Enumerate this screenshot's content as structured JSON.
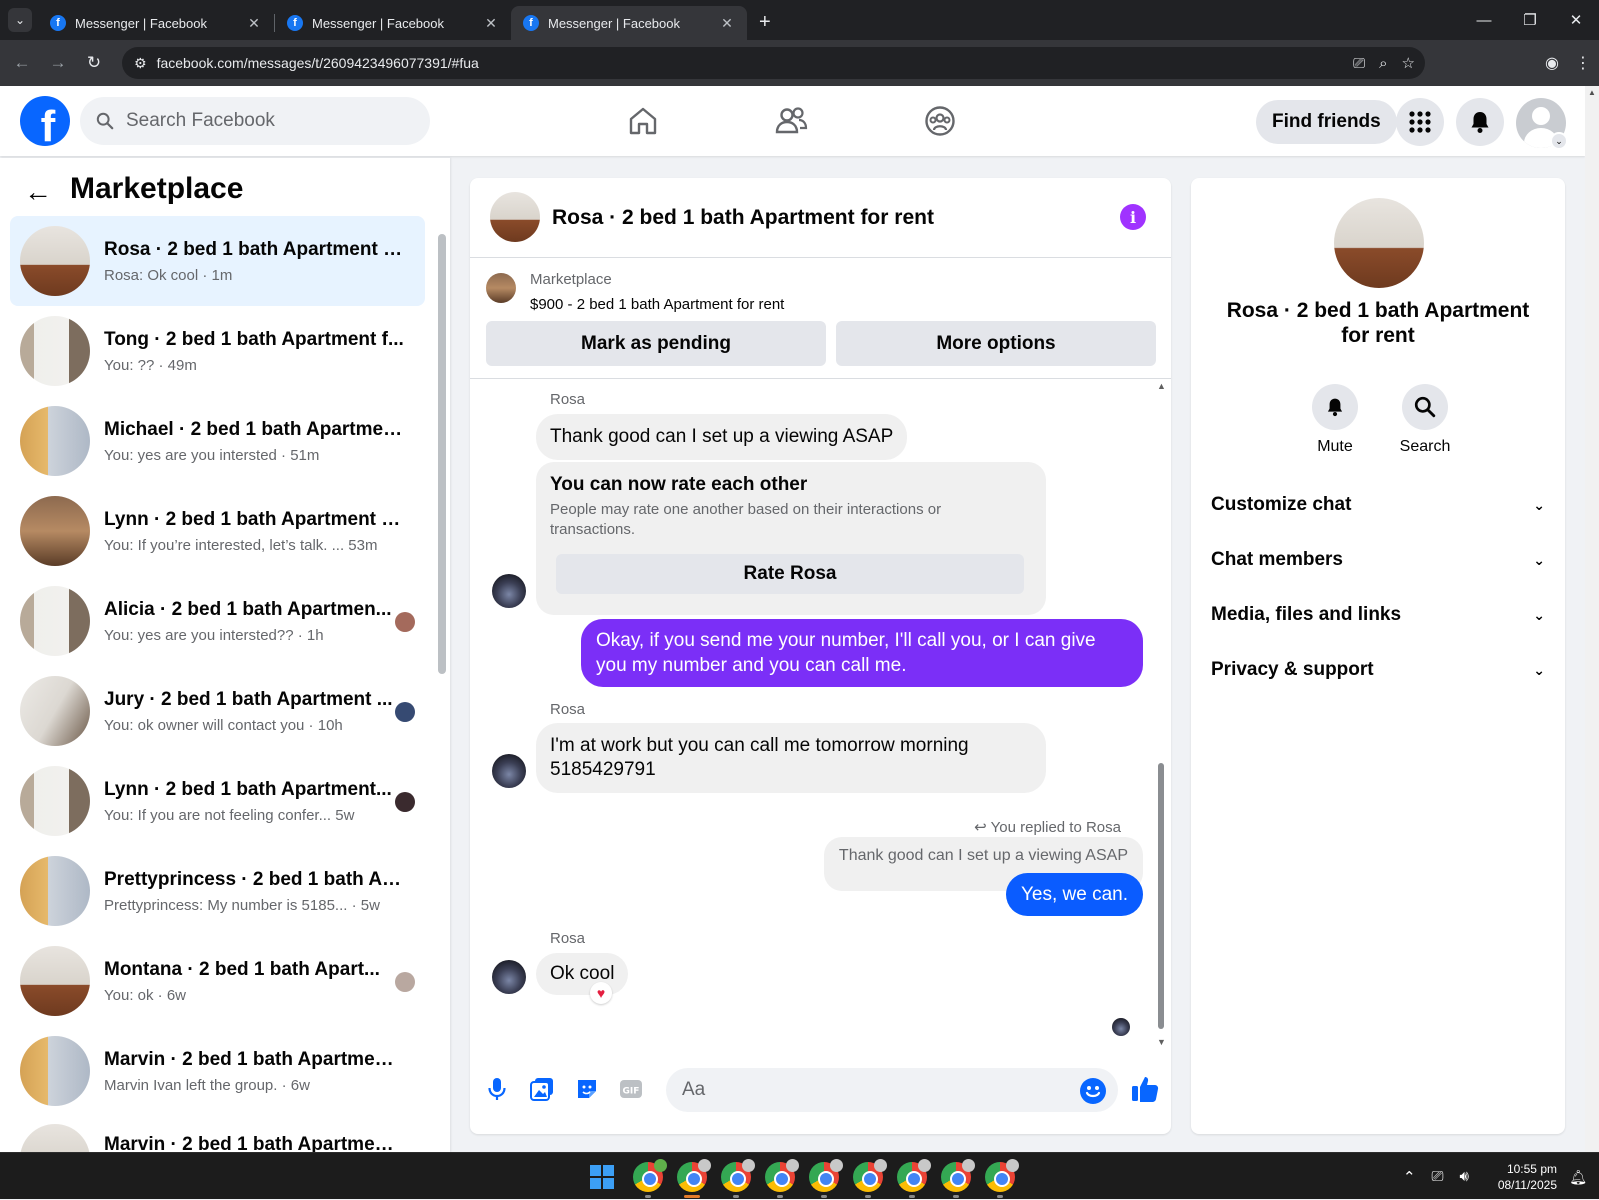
{
  "browser": {
    "tabs": [
      {
        "title": "Messenger | Facebook"
      },
      {
        "title": "Messenger | Facebook"
      },
      {
        "title": "Messenger | Facebook"
      }
    ],
    "url": "facebook.com/messages/t/2609423496077391/#fua"
  },
  "header": {
    "search_placeholder": "Search Facebook",
    "find_friends": "Find friends"
  },
  "left": {
    "title": "Marketplace",
    "conversations": [
      {
        "name": "Rosa · 2 bed 1 bath Apartment fo...",
        "preview": "Rosa: Ok cool · 1m",
        "selected": true
      },
      {
        "name": "Tong · 2 bed 1 bath Apartment f...",
        "preview": "You: ?? · 49m"
      },
      {
        "name": "Michael · 2 bed 1 bath Apartmen...",
        "preview": "You: yes are you intersted · 51m"
      },
      {
        "name": "Lynn · 2 bed 1 bath Apartment fo...",
        "preview": "You: If you’re interested, let’s talk. ... 53m"
      },
      {
        "name": "Alicia · 2 bed 1 bath Apartmen...",
        "preview": "You: yes are you intersted?? · 1h"
      },
      {
        "name": "Jury · 2 bed 1 bath Apartment ...",
        "preview": "You: ok owner will contact you · 10h"
      },
      {
        "name": "Lynn · 2 bed 1 bath Apartment...",
        "preview": "You: If you are not feeling confer...  5w"
      },
      {
        "name": "Prettyprincess · 2 bed 1 bath Apa...",
        "preview": "Prettyprincess: My number is 5185...  · 5w"
      },
      {
        "name": "Montana · 2 bed 1 bath Apart...",
        "preview": "You: ok · 6w"
      },
      {
        "name": "Marvin · 2 bed 1 bath Apartment...",
        "preview": "Marvin Ivan left the group. · 6w"
      },
      {
        "name": "Marvin · 2 bed 1 bath Apartment...",
        "preview": ""
      }
    ]
  },
  "chat": {
    "title": "Rosa · 2 bed 1 bath Apartment for rent",
    "marketplace_label": "Marketplace",
    "listing": "$900 - 2 bed 1 bath Apartment for rent",
    "mark_pending": "Mark as pending",
    "more_options": "More options",
    "sender": "Rosa",
    "msg1": "Thank good can I set up a viewing ASAP",
    "rate_title": "You can now rate each other",
    "rate_desc": "People may rate one another based on their interactions or transactions.",
    "rate_button": "Rate Rosa",
    "out1": "Okay, if you send me your number, I'll call you, or I can give you my number and you can call me.",
    "msg2": "I'm at work but you can call me tomorrow morning 5185429791",
    "reply_note": "You replied to Rosa",
    "quoted": "Thank good can I set up a viewing ASAP",
    "out2": "Yes, we can.",
    "msg3": "Ok cool",
    "input_placeholder": "Aa"
  },
  "right": {
    "title": "Rosa · 2 bed 1 bath Apartment for rent",
    "mute": "Mute",
    "search": "Search",
    "sections": [
      "Customize chat",
      "Chat members",
      "Media, files and links",
      "Privacy & support"
    ]
  },
  "taskbar": {
    "time": "10:55 pm",
    "date": "08/11/2025"
  },
  "colors": {
    "fb_blue": "#0866ff",
    "purple_bubble": "#7b2ff7",
    "blue_bubble": "#0a5cff"
  }
}
